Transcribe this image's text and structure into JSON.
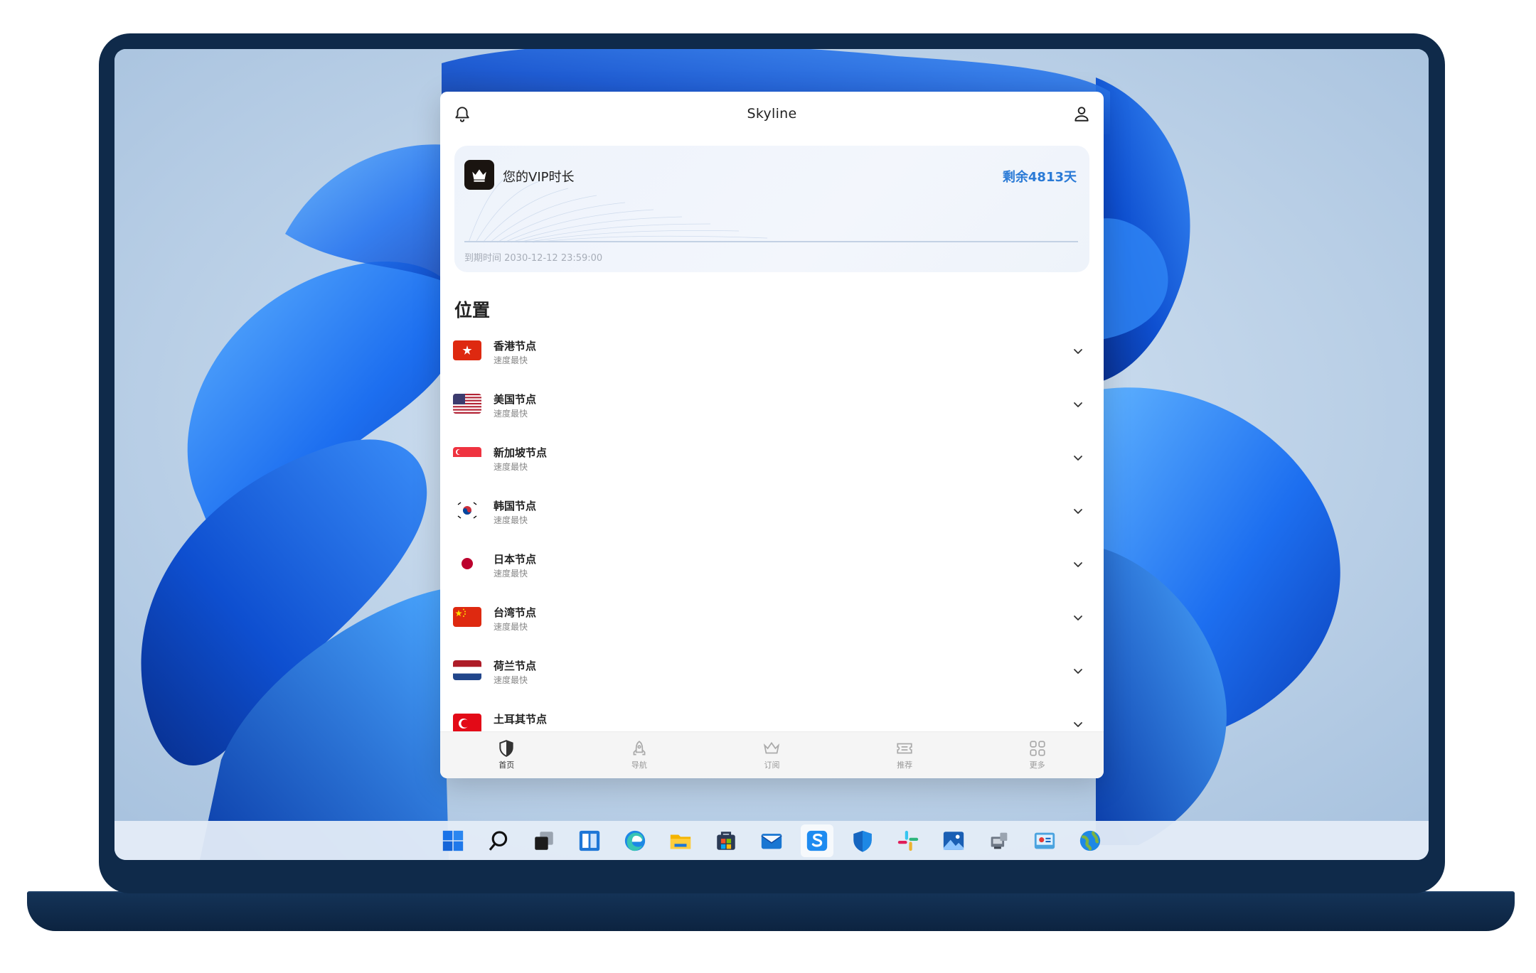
{
  "app": {
    "title": "Skyline"
  },
  "vip": {
    "label": "您的VIP时长",
    "remaining": "剩余4813天",
    "expiry": "到期时间 2030-12-12 23:59:00"
  },
  "locations_title": "位置",
  "locations": [
    {
      "name": "香港节点",
      "subtitle": "速度最快",
      "flag": "hong-kong"
    },
    {
      "name": "美国节点",
      "subtitle": "速度最快",
      "flag": "united-states"
    },
    {
      "name": "新加坡节点",
      "subtitle": "速度最快",
      "flag": "singapore"
    },
    {
      "name": "韩国节点",
      "subtitle": "速度最快",
      "flag": "south-korea"
    },
    {
      "name": "日本节点",
      "subtitle": "速度最快",
      "flag": "japan"
    },
    {
      "name": "台湾节点",
      "subtitle": "速度最快",
      "flag": "china"
    },
    {
      "name": "荷兰节点",
      "subtitle": "速度最快",
      "flag": "netherlands"
    },
    {
      "name": "土耳其节点",
      "subtitle": "",
      "flag": "turkey"
    }
  ],
  "nav": [
    {
      "label": "首页",
      "icon": "shield-icon",
      "active": true
    },
    {
      "label": "导航",
      "icon": "rocket-icon",
      "active": false
    },
    {
      "label": "订阅",
      "icon": "crown-icon",
      "active": false
    },
    {
      "label": "推荐",
      "icon": "ticket-icon",
      "active": false
    },
    {
      "label": "更多",
      "icon": "grid-icon",
      "active": false
    }
  ],
  "taskbar": [
    "windows-start-icon",
    "search-icon",
    "task-view-icon",
    "widgets-icon",
    "edge-icon",
    "file-explorer-icon",
    "store-icon",
    "mail-icon",
    "skyline-app-icon",
    "defender-icon",
    "slack-icon",
    "photos-icon",
    "devices-icon",
    "control-panel-icon",
    "globe-icon"
  ],
  "colors": {
    "accent": "#2a7ad6",
    "bezel": "#0f2a4a",
    "wallpaper": "#1e6fe0"
  }
}
